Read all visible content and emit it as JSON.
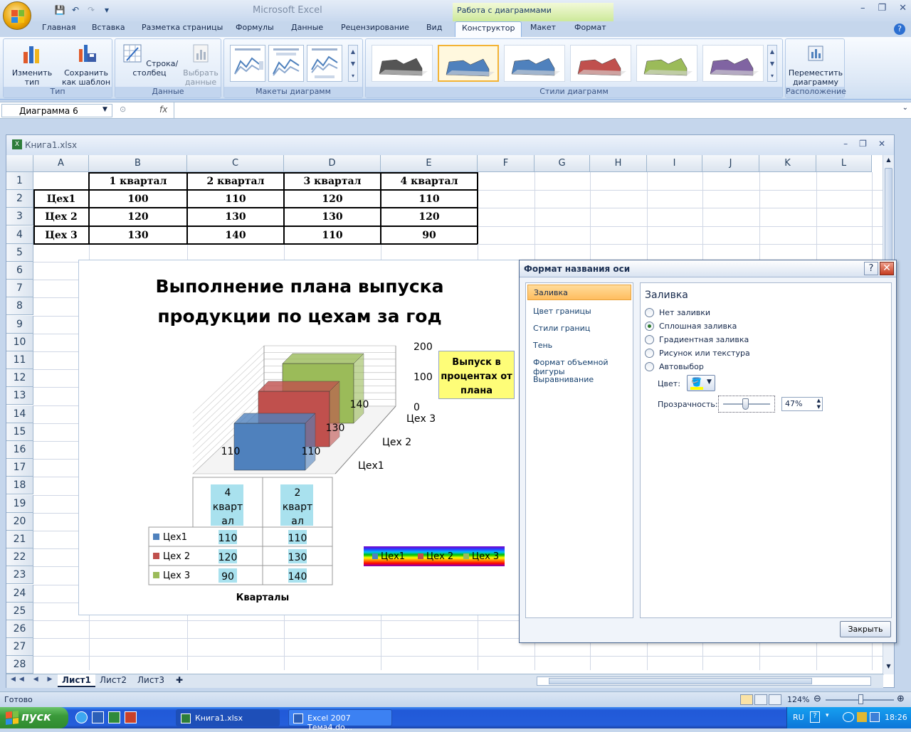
{
  "app": {
    "title": "Microsoft Excel",
    "context_tab_group": "Работа с диаграммами"
  },
  "ribbon_tabs": [
    "Главная",
    "Вставка",
    "Разметка страницы",
    "Формулы",
    "Данные",
    "Рецензирование",
    "Вид",
    "Конструктор",
    "Макет",
    "Формат"
  ],
  "active_tab": "Конструктор",
  "ribbon": {
    "groups": {
      "type": "Тип",
      "data": "Данные",
      "layouts": "Макеты диаграмм",
      "styles": "Стили диаграмм",
      "location": "Расположение"
    },
    "buttons": {
      "change_type": "Изменить тип диаграммы",
      "save_template": "Сохранить как шаблон",
      "row_col": "Строка/столбец",
      "select_data": "Выбрать данные",
      "move_chart": "Переместить диаграмму"
    },
    "style_colors": [
      "#555555",
      "#4f81bd",
      "#4f81bd",
      "#c0504d",
      "#9bbb59",
      "#8064a2"
    ]
  },
  "formula_bar": {
    "name_box": "Диаграмма 6",
    "fx": "fx",
    "formula": ""
  },
  "workbook": {
    "title": "Книга1.xlsx"
  },
  "columns": [
    "A",
    "B",
    "C",
    "D",
    "E",
    "F",
    "G",
    "H",
    "I",
    "J",
    "K",
    "L"
  ],
  "rows": [
    "1",
    "2",
    "3",
    "4",
    "5",
    "6",
    "7",
    "8",
    "9",
    "10",
    "11",
    "12",
    "13",
    "14",
    "15",
    "16",
    "17",
    "18",
    "19",
    "20",
    "21",
    "22",
    "23",
    "24",
    "25",
    "26",
    "27",
    "28"
  ],
  "table": {
    "headers": [
      "",
      "1 квартал",
      "2 квартал",
      "3 квартал",
      "4 квартал"
    ],
    "rows": [
      [
        "Цех1",
        "100",
        "110",
        "120",
        "110"
      ],
      [
        "Цех 2",
        "120",
        "130",
        "130",
        "120"
      ],
      [
        "Цех 3",
        "130",
        "140",
        "110",
        "90"
      ]
    ]
  },
  "chart": {
    "title_line1": "Выполнение плана выпуска",
    "title_line2": "продукции по цехам за год",
    "axis_ticks": [
      "200",
      "100",
      "0"
    ],
    "depth_labels": [
      "Цех 3",
      "Цех 2",
      "Цех1"
    ],
    "callout": "Выпуск в процентах от плана",
    "x_axis_title": "Кварталы",
    "table_headers": [
      "4 квартал",
      "2 квартал"
    ],
    "legend": [
      "Цех1",
      "Цех 2",
      "Цех 3"
    ],
    "series_colors": [
      "#4f81bd",
      "#c0504d",
      "#9bbb59"
    ]
  },
  "chart_data": {
    "type": "bar",
    "title": "Выполнение плана выпуска продукции по цехам за год",
    "categories": [
      "4 квартал",
      "2 квартал"
    ],
    "series": [
      {
        "name": "Цех1",
        "values": [
          110,
          110
        ]
      },
      {
        "name": "Цех 2",
        "values": [
          120,
          130
        ]
      },
      {
        "name": "Цех 3",
        "values": [
          90,
          140
        ]
      }
    ],
    "xlabel": "Кварталы",
    "ylabel": "Выпуск в процентах от плана",
    "ylim": [
      0,
      200
    ],
    "legend": "bottom-right",
    "grid": true
  },
  "dialog": {
    "title": "Формат названия оси",
    "nav": [
      "Заливка",
      "Цвет границы",
      "Стили границ",
      "Тень",
      "Формат объемной фигуры",
      "Выравнивание"
    ],
    "section_title": "Заливка",
    "options": [
      "Нет заливки",
      "Сплошная заливка",
      "Градиентная заливка",
      "Рисунок или текстура",
      "Автовыбор"
    ],
    "selected_option": "Сплошная заливка",
    "color_label": "Цвет:",
    "transparency_label": "Прозрачность:",
    "transparency_value": "47%",
    "transparency_fraction": 0.47,
    "close_label": "Закрыть"
  },
  "sheets": [
    "Лист1",
    "Лист2",
    "Лист3"
  ],
  "status": {
    "ready": "Готово",
    "zoom": "124%"
  },
  "taskbar": {
    "start": "пуск",
    "items": [
      "Книга1.xlsx",
      "Excel 2007 Тема4.do..."
    ],
    "lang": "RU",
    "time": "18:26"
  }
}
